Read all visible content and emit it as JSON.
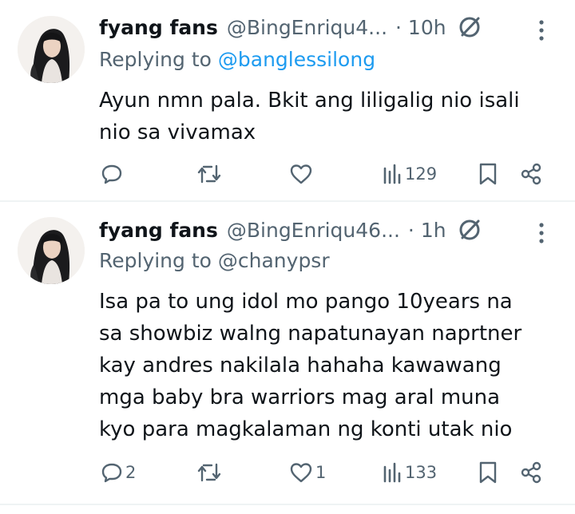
{
  "tweets": [
    {
      "name": "fyang fans",
      "handle": "@BingEnriqu4...",
      "time": "· 10h",
      "replying_prefix": "Replying to ",
      "replying_to": "@banglessilong",
      "lines": [
        "Ayun nmn pala. Bkit ang liligalig nio  isali",
        "nio sa vivamax"
      ],
      "replies": "",
      "retweets": "",
      "likes": "",
      "views": "129"
    },
    {
      "name": "fyang fans",
      "handle": "@BingEnriqu46...",
      "time": "· 1h",
      "replying_prefix": "Replying to ",
      "replying_to": "@chanypsr",
      "lines": [
        "Isa pa to ung idol mo pango 10years na",
        "sa showbiz walng napatunayan naprtner",
        "kay andres nakilala hahaha kawawang",
        "mga baby bra warriors mag aral muna",
        "kyo para magkalaman ng konti utak nio"
      ],
      "replies": "2",
      "retweets": "",
      "likes": "1",
      "views": "133"
    }
  ],
  "colors": {
    "text": "#0f1419",
    "secondary": "#536471",
    "accent": "#1d9bf0",
    "divider": "#eff3f4"
  },
  "icons": [
    "gray-check-badge-icon",
    "more-dots-icon",
    "reply-icon",
    "retweet-icon",
    "like-icon",
    "views-icon",
    "bookmark-icon",
    "share-icon"
  ]
}
